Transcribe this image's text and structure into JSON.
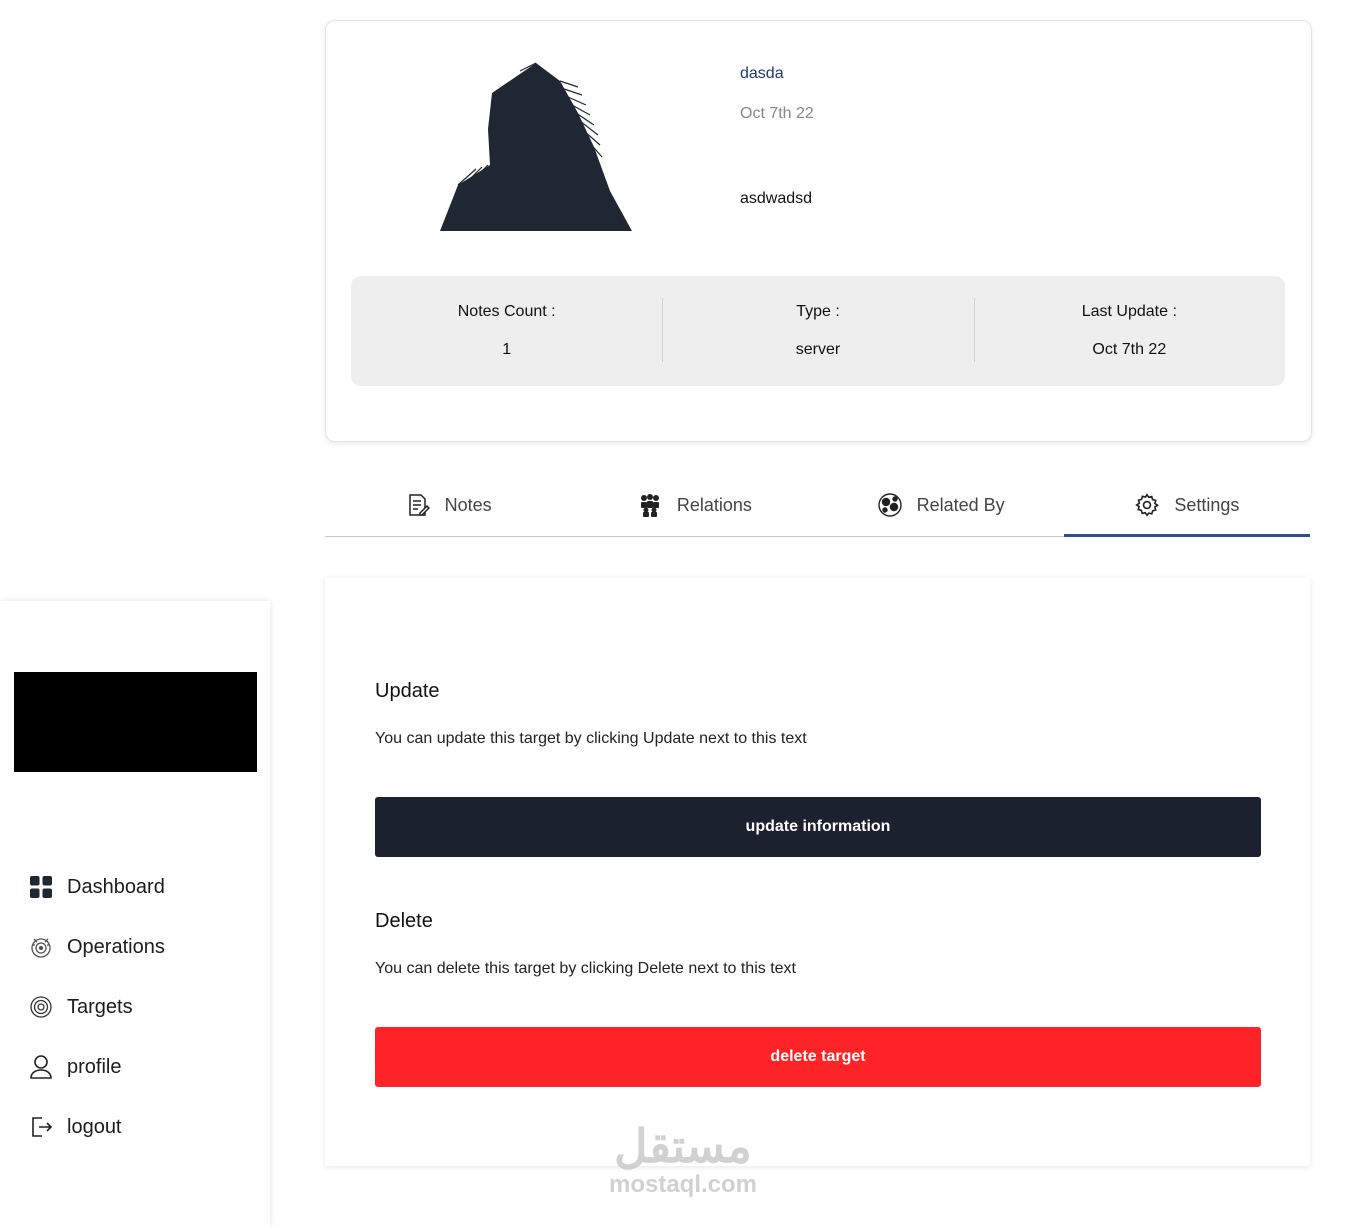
{
  "profile": {
    "name": "dasda",
    "date": "Oct 7th 22",
    "description": "asdwadsd",
    "avatar_icon": "hooded-person-icon"
  },
  "stats": [
    {
      "label": "Notes Count :",
      "value": "1"
    },
    {
      "label": "Type :",
      "value": "server"
    },
    {
      "label": "Last Update :",
      "value": "Oct 7th 22"
    }
  ],
  "tabs": [
    {
      "label": "Notes",
      "icon": "notes-icon"
    },
    {
      "label": "Relations",
      "icon": "relations-icon"
    },
    {
      "label": "Related By",
      "icon": "related-by-icon"
    },
    {
      "label": "Settings",
      "icon": "gear-icon",
      "active": true
    }
  ],
  "settings": {
    "update_title": "Update",
    "update_text": "You can update this target by clicking Update next to this text",
    "update_button": "update information",
    "delete_title": "Delete",
    "delete_text": "You can delete this target by clicking Delete next to this text",
    "delete_button": "delete target"
  },
  "sidebar": {
    "items": [
      {
        "label": "Dashboard",
        "icon": "dashboard-icon"
      },
      {
        "label": "Operations",
        "icon": "operations-icon"
      },
      {
        "label": "Targets",
        "icon": "target-icon"
      },
      {
        "label": "profile",
        "icon": "user-icon"
      },
      {
        "label": "logout",
        "icon": "logout-icon"
      }
    ]
  },
  "watermark": {
    "arabic": "مستقل",
    "latin": "mostaql.com"
  },
  "colors": {
    "accent": "#2f4da0",
    "dark_button": "#1b212e",
    "danger": "#fd2327",
    "name_link": "#1e3a6e"
  }
}
